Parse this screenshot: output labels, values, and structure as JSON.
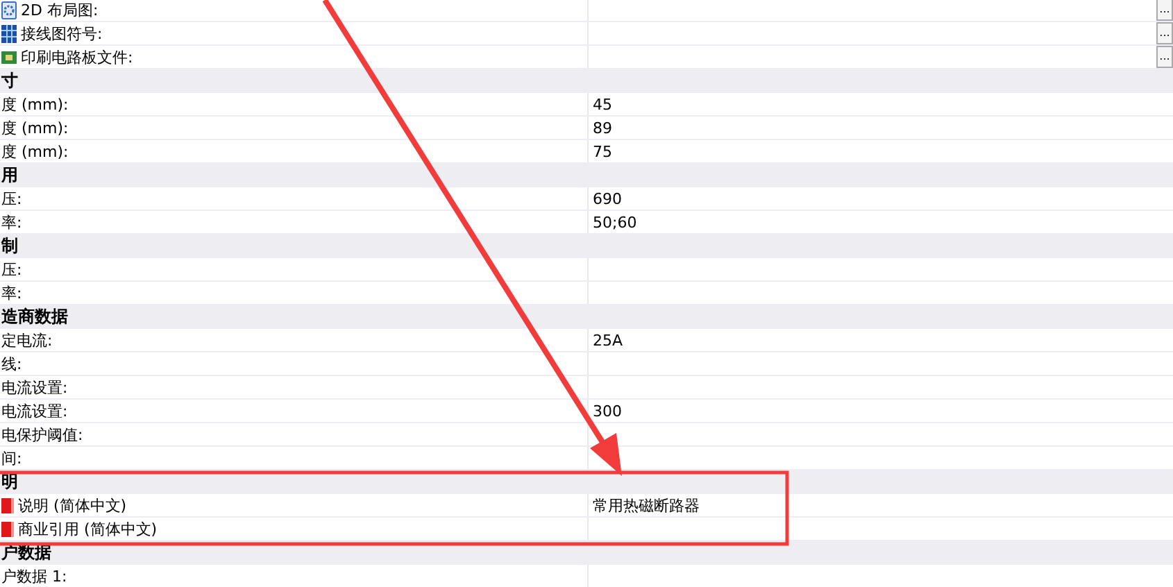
{
  "rows": [
    {
      "kind": "file",
      "label": "2D 布局图:",
      "value": "",
      "button": "..."
    },
    {
      "kind": "file",
      "label": "接线图符号:",
      "value": "",
      "button": "..."
    },
    {
      "kind": "file",
      "label": "印刷电路板文件:",
      "value": "",
      "button": "..."
    },
    {
      "kind": "header",
      "label": "寸"
    },
    {
      "kind": "property",
      "label": "度 (mm):",
      "value": "45"
    },
    {
      "kind": "property",
      "label": "度 (mm):",
      "value": "89"
    },
    {
      "kind": "property",
      "label": "度 (mm):",
      "value": "75"
    },
    {
      "kind": "header",
      "label": "用"
    },
    {
      "kind": "property",
      "label": "压:",
      "value": "690"
    },
    {
      "kind": "property",
      "label": "率:",
      "value": "50;60"
    },
    {
      "kind": "header",
      "label": "制"
    },
    {
      "kind": "property",
      "label": "压:",
      "value": ""
    },
    {
      "kind": "property",
      "label": "率:",
      "value": ""
    },
    {
      "kind": "header",
      "label": "造商数据"
    },
    {
      "kind": "property",
      "label": "定电流:",
      "value": "25A"
    },
    {
      "kind": "property",
      "label": "线:",
      "value": ""
    },
    {
      "kind": "property",
      "label": "电流设置:",
      "value": ""
    },
    {
      "kind": "property",
      "label": "电流设置:",
      "value": "300"
    },
    {
      "kind": "property",
      "label": "电保护阈值:",
      "value": ""
    },
    {
      "kind": "property",
      "label": "间:",
      "value": ""
    },
    {
      "kind": "header",
      "label": "明"
    },
    {
      "kind": "text",
      "label": "说明 (简体中文)",
      "value": "常用热磁断路器"
    },
    {
      "kind": "text",
      "label": "商业引用 (简体中文)",
      "value": ""
    },
    {
      "kind": "header",
      "label": "户数据"
    },
    {
      "kind": "property",
      "label": "户数据 1:",
      "value": ""
    }
  ]
}
